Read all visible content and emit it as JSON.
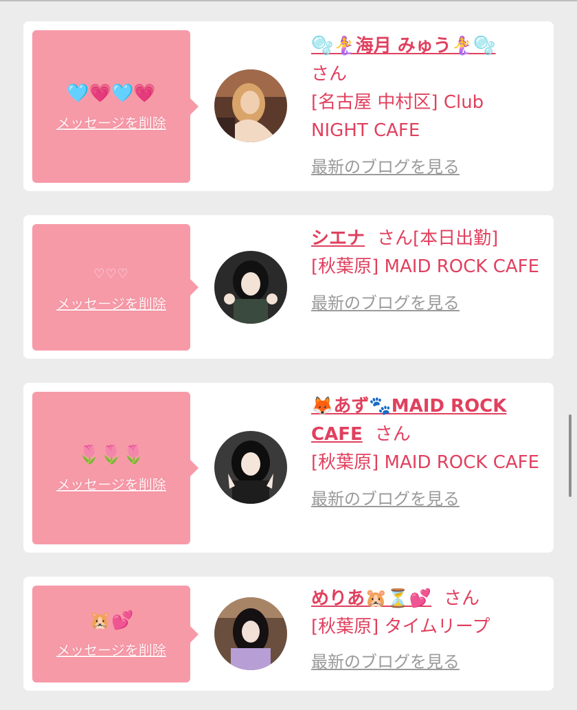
{
  "cards": [
    {
      "message": "🩵💗🩵💗",
      "delete_label": "メッセージを削除",
      "name": "🫧🧜‍♀️海月 みゅう🧜‍♀️🫧",
      "honorific": "さん",
      "extra": "",
      "location": "[名古屋 中村区] Club NIGHT CAFE",
      "blog_label": "最新のブログを見る"
    },
    {
      "message": "♡♡♡",
      "delete_label": "メッセージを削除",
      "name": "シエナ",
      "honorific": "さん",
      "extra": "[本日出勤]",
      "location": "[秋葉原] MAID ROCK CAFE",
      "blog_label": "最新のブログを見る"
    },
    {
      "message": "🌷🌷🌷",
      "delete_label": "メッセージを削除",
      "name": "🦊あず🐾MAID ROCK CAFE",
      "honorific": "さん",
      "extra": "",
      "location": "[秋葉原] MAID ROCK CAFE",
      "blog_label": "最新のブログを見る"
    },
    {
      "message": "🐹💕",
      "delete_label": "メッセージを削除",
      "name": "めりあ🐹⏳💕",
      "honorific": "さん",
      "extra": "",
      "location": "[秋葉原] タイムリープ",
      "blog_label": "最新のブログを見る"
    }
  ],
  "colors": {
    "accent": "#e0405e",
    "bubble": "#f79aa8",
    "link_gray": "#9a9a9a",
    "background": "#ececec"
  }
}
